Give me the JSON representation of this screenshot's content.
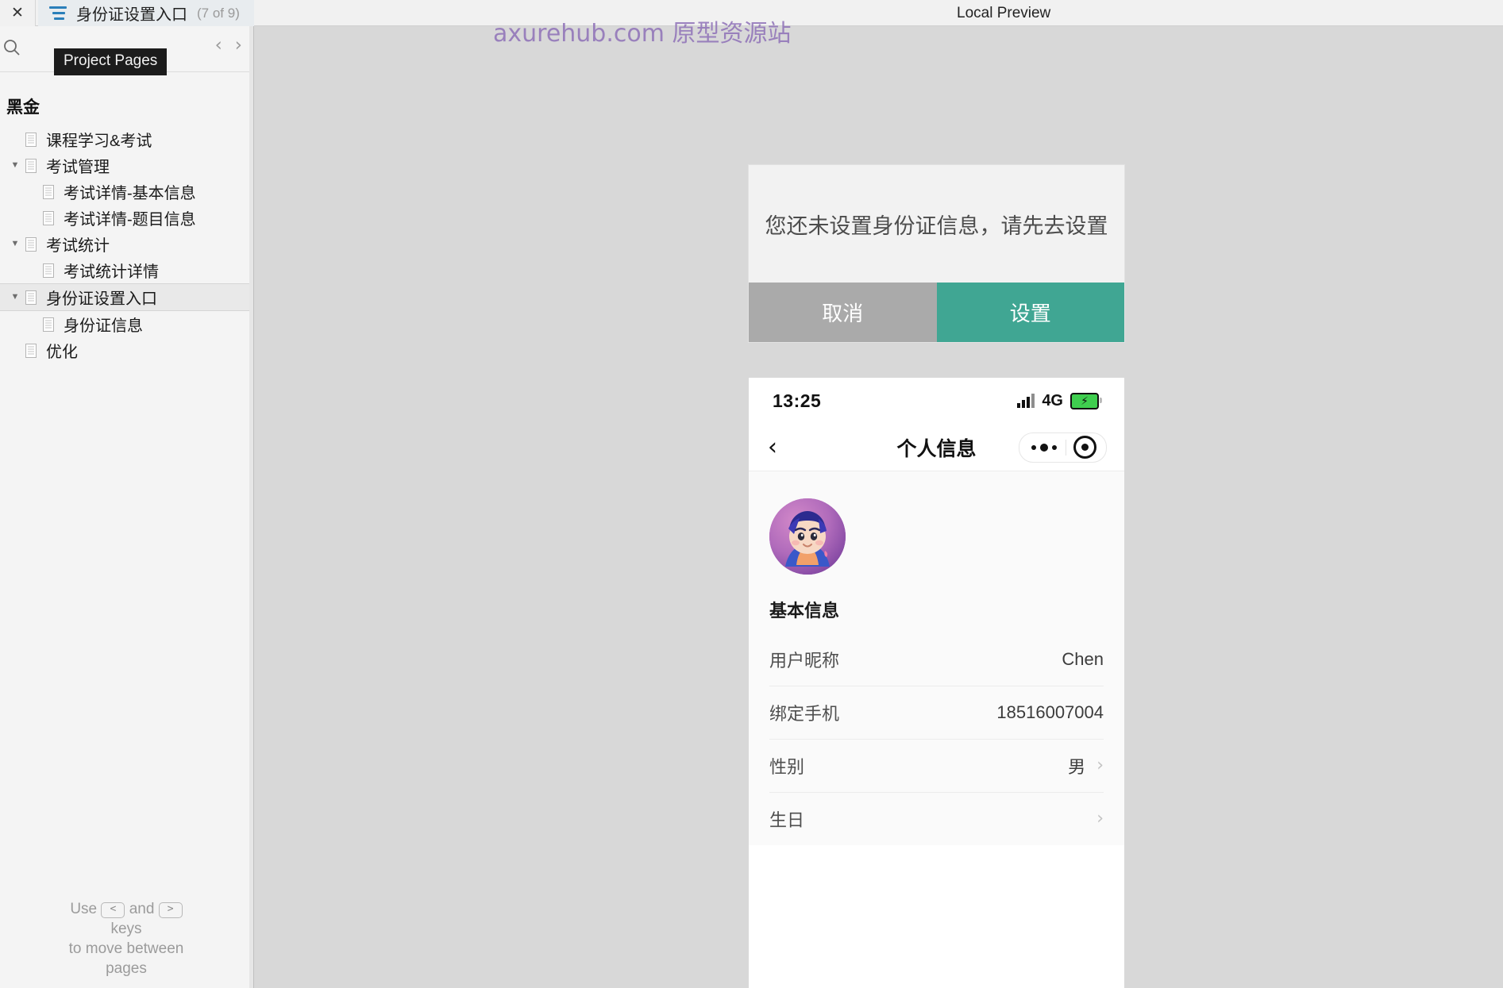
{
  "topbar": {
    "close_label": "✕",
    "tab_title": "身份证设置入口",
    "tab_count": "(7 of 9)",
    "local_preview": "Local Preview"
  },
  "sidebar": {
    "tooltip": "Project Pages",
    "prev_arrow": "‹",
    "next_arrow": "›",
    "root_label": "黑金",
    "items": [
      {
        "label": "课程学习&考试",
        "depth": 1,
        "twisty": "",
        "selected": false
      },
      {
        "label": "考试管理",
        "depth": 1,
        "twisty": "▼",
        "selected": false
      },
      {
        "label": "考试详情-基本信息",
        "depth": 2,
        "twisty": "",
        "selected": false
      },
      {
        "label": "考试详情-题目信息",
        "depth": 2,
        "twisty": "",
        "selected": false
      },
      {
        "label": "考试统计",
        "depth": 1,
        "twisty": "▼",
        "selected": false
      },
      {
        "label": "考试统计详情",
        "depth": 2,
        "twisty": "",
        "selected": false
      },
      {
        "label": "身份证设置入口",
        "depth": 1,
        "twisty": "▼",
        "selected": true
      },
      {
        "label": "身份证信息",
        "depth": 2,
        "twisty": "",
        "selected": false
      },
      {
        "label": "优化",
        "depth": 1,
        "twisty": "",
        "selected": false
      }
    ],
    "hint": {
      "use": "Use",
      "key_prev": "<",
      "and": "and",
      "key_next": ">",
      "line2": "keys",
      "line3": "to move between",
      "line4": "pages"
    }
  },
  "canvas": {
    "watermark": "axurehub.com 原型资源站",
    "background_color": "#d8d8d8"
  },
  "dialog": {
    "message": "您还未设置身份证信息，请先去设置",
    "cancel_label": "取消",
    "confirm_label": "设置",
    "cancel_color": "#aaaaaa",
    "confirm_color": "#40a693"
  },
  "phone": {
    "status": {
      "time": "13:25",
      "network": "4G",
      "signal_icon": "signal-bars-icon",
      "battery_icon": "battery-charging-icon",
      "battery_color": "#3fce4f"
    },
    "nav": {
      "back_icon": "‹",
      "title": "个人信息",
      "more_icon": "more-dots-icon",
      "target_icon": "target-circle-icon"
    },
    "avatar_name": "user-avatar",
    "section_title": "基本信息",
    "rows": [
      {
        "label": "用户昵称",
        "value": "Chen",
        "chevron": ""
      },
      {
        "label": "绑定手机",
        "value": "18516007004",
        "chevron": ""
      },
      {
        "label": "性别",
        "value": "男",
        "chevron": "›"
      },
      {
        "label": "生日",
        "value": "",
        "chevron": "›"
      }
    ]
  }
}
